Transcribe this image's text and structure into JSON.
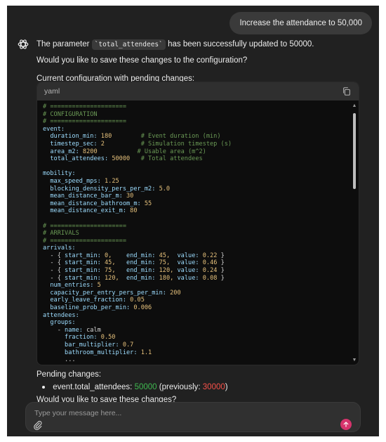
{
  "user_message": "Increase the attendance to 50,000",
  "assistant": {
    "param_pre": "The parameter",
    "param_name": "`total_attendees`",
    "param_post": "has been successfully updated to 50000.",
    "question": "Would you like to save these changes to the configuration?",
    "config_heading": "Current configuration with pending changes:"
  },
  "code_block": {
    "language": "yaml",
    "lines": [
      [
        {
          "t": "# =====================",
          "c": "comment"
        }
      ],
      [
        {
          "t": "# CONFIGURATION",
          "c": "comment"
        }
      ],
      [
        {
          "t": "# =====================",
          "c": "comment"
        }
      ],
      [
        {
          "t": "event:",
          "c": "key"
        }
      ],
      [
        {
          "t": "  duration_min:",
          "c": "key"
        },
        {
          "t": " 180",
          "c": "num"
        },
        {
          "t": "        # Event duration (min)",
          "c": "comment"
        }
      ],
      [
        {
          "t": "  timestep_sec:",
          "c": "key"
        },
        {
          "t": " 2",
          "c": "num"
        },
        {
          "t": "          # Simulation timestep (s)",
          "c": "comment"
        }
      ],
      [
        {
          "t": "  area_m2:",
          "c": "key"
        },
        {
          "t": " 8200",
          "c": "num"
        },
        {
          "t": "           # Usable area (m^2)",
          "c": "comment"
        }
      ],
      [
        {
          "t": "  total_attendees:",
          "c": "key"
        },
        {
          "t": " 50000",
          "c": "num"
        },
        {
          "t": "   # Total attendees",
          "c": "comment"
        }
      ],
      [
        {
          "t": "",
          "c": "punc"
        }
      ],
      [
        {
          "t": "mobility:",
          "c": "key"
        }
      ],
      [
        {
          "t": "  max_speed_mps:",
          "c": "key"
        },
        {
          "t": " 1.25",
          "c": "num"
        }
      ],
      [
        {
          "t": "  blocking_density_pers_per_m2:",
          "c": "key"
        },
        {
          "t": " 5.0",
          "c": "num"
        }
      ],
      [
        {
          "t": "  mean_distance_bar_m:",
          "c": "key"
        },
        {
          "t": " 30",
          "c": "num"
        }
      ],
      [
        {
          "t": "  mean_distance_bathroom_m:",
          "c": "key"
        },
        {
          "t": " 55",
          "c": "num"
        }
      ],
      [
        {
          "t": "  mean_distance_exit_m:",
          "c": "key"
        },
        {
          "t": " 80",
          "c": "num"
        }
      ],
      [
        {
          "t": "",
          "c": "punc"
        }
      ],
      [
        {
          "t": "# =====================",
          "c": "comment"
        }
      ],
      [
        {
          "t": "# ARRIVALS",
          "c": "comment"
        }
      ],
      [
        {
          "t": "# =====================",
          "c": "comment"
        }
      ],
      [
        {
          "t": "arrivals:",
          "c": "key"
        }
      ],
      [
        {
          "t": "  - { ",
          "c": "punc"
        },
        {
          "t": "start_min:",
          "c": "key"
        },
        {
          "t": " 0,",
          "c": "num"
        },
        {
          "t": "    ",
          "c": "punc"
        },
        {
          "t": "end_min:",
          "c": "key"
        },
        {
          "t": " 45,",
          "c": "num"
        },
        {
          "t": "  ",
          "c": "punc"
        },
        {
          "t": "value:",
          "c": "key"
        },
        {
          "t": " 0.22",
          "c": "num"
        },
        {
          "t": " }",
          "c": "punc"
        }
      ],
      [
        {
          "t": "  - { ",
          "c": "punc"
        },
        {
          "t": "start_min:",
          "c": "key"
        },
        {
          "t": " 45,",
          "c": "num"
        },
        {
          "t": "   ",
          "c": "punc"
        },
        {
          "t": "end_min:",
          "c": "key"
        },
        {
          "t": " 75,",
          "c": "num"
        },
        {
          "t": "  ",
          "c": "punc"
        },
        {
          "t": "value:",
          "c": "key"
        },
        {
          "t": " 0.46",
          "c": "num"
        },
        {
          "t": " }",
          "c": "punc"
        }
      ],
      [
        {
          "t": "  - { ",
          "c": "punc"
        },
        {
          "t": "start_min:",
          "c": "key"
        },
        {
          "t": " 75,",
          "c": "num"
        },
        {
          "t": "   ",
          "c": "punc"
        },
        {
          "t": "end_min:",
          "c": "key"
        },
        {
          "t": " 120,",
          "c": "num"
        },
        {
          "t": " ",
          "c": "punc"
        },
        {
          "t": "value:",
          "c": "key"
        },
        {
          "t": " 0.24",
          "c": "num"
        },
        {
          "t": " }",
          "c": "punc"
        }
      ],
      [
        {
          "t": "  - { ",
          "c": "punc"
        },
        {
          "t": "start_min:",
          "c": "key"
        },
        {
          "t": " 120,",
          "c": "num"
        },
        {
          "t": "  ",
          "c": "punc"
        },
        {
          "t": "end_min:",
          "c": "key"
        },
        {
          "t": " 180,",
          "c": "num"
        },
        {
          "t": " ",
          "c": "punc"
        },
        {
          "t": "value:",
          "c": "key"
        },
        {
          "t": " 0.08",
          "c": "num"
        },
        {
          "t": " }",
          "c": "punc"
        }
      ],
      [
        {
          "t": "  num_entries:",
          "c": "key"
        },
        {
          "t": " 5",
          "c": "num"
        }
      ],
      [
        {
          "t": "  capacity_per_entry_pers_per_min:",
          "c": "key"
        },
        {
          "t": " 200",
          "c": "num"
        }
      ],
      [
        {
          "t": "  early_leave_fraction:",
          "c": "key"
        },
        {
          "t": " 0.05",
          "c": "num"
        }
      ],
      [
        {
          "t": "  baseline_prob_per_min:",
          "c": "key"
        },
        {
          "t": " 0.006",
          "c": "num"
        }
      ],
      [
        {
          "t": "attendees:",
          "c": "key"
        }
      ],
      [
        {
          "t": "  groups:",
          "c": "key"
        }
      ],
      [
        {
          "t": "    - ",
          "c": "punc"
        },
        {
          "t": "name:",
          "c": "key"
        },
        {
          "t": " calm",
          "c": "punc"
        }
      ],
      [
        {
          "t": "      fraction:",
          "c": "key"
        },
        {
          "t": " 0.50",
          "c": "num"
        }
      ],
      [
        {
          "t": "      bar_multiplier:",
          "c": "key"
        },
        {
          "t": " 0.7",
          "c": "num"
        }
      ],
      [
        {
          "t": "      bathroom_multiplier:",
          "c": "key"
        },
        {
          "t": " 1.1",
          "c": "num"
        }
      ],
      [
        {
          "t": "      ...",
          "c": "punc"
        }
      ]
    ]
  },
  "pending": {
    "heading": "Pending changes:",
    "item_key": "event.total_attendees:",
    "new_value": "50000",
    "prev_label": "(previously:",
    "old_value": "30000",
    "prev_close": ")",
    "question": "Would you like to save these changes?"
  },
  "composer": {
    "placeholder": "Type your message here..."
  },
  "colors": {
    "comment": "#6a9955",
    "key": "#9cdcfe",
    "num": "#e5c07b",
    "send": "#d6336c"
  }
}
